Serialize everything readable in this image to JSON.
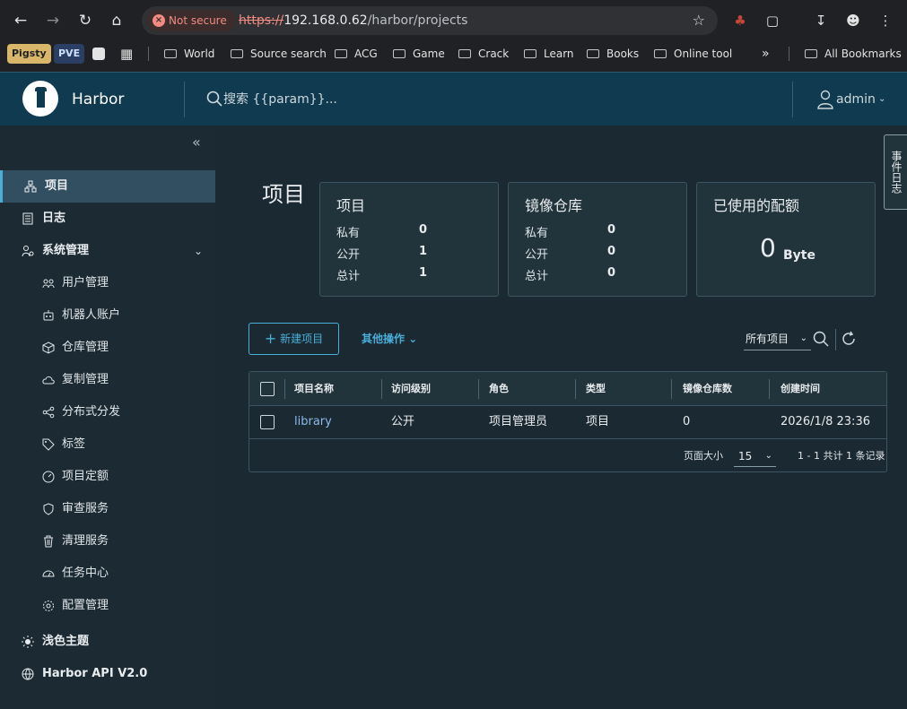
{
  "browser": {
    "security_label": "Not secure",
    "url_scheme": "https://",
    "url_host": "192.168.0.62",
    "url_path": "/harbor/projects",
    "bookmarks": {
      "pigsty": "Pigsty",
      "pve": "PVE",
      "world": "World",
      "source_search": "Source search",
      "acg": "ACG",
      "game": "Game",
      "crack": "Crack",
      "learn": "Learn",
      "books": "Books",
      "online_tool": "Online tool",
      "more": "»",
      "all_bookmarks": "All Bookmarks"
    }
  },
  "header": {
    "brand": "Harbor",
    "search_placeholder": "搜索 {{param}}...",
    "user": "admin"
  },
  "sidebar": {
    "projects": "项目",
    "logs": "日志",
    "admin": "系统管理",
    "sub": {
      "users": "用户管理",
      "robots": "机器人账户",
      "registries": "仓库管理",
      "replications": "复制管理",
      "distributions": "分布式分发",
      "labels": "标签",
      "quotas": "项目定额",
      "interrogation": "审查服务",
      "gc": "清理服务",
      "jobs": "任务中心",
      "config": "配置管理"
    },
    "theme": "浅色主题",
    "api": "Harbor API V2.0"
  },
  "main": {
    "title": "项目",
    "cards": {
      "projects": {
        "title": "项目",
        "private_label": "私有",
        "private_value": "0",
        "public_label": "公开",
        "public_value": "1",
        "total_label": "总计",
        "total_value": "1"
      },
      "repos": {
        "title": "镜像仓库",
        "private_label": "私有",
        "private_value": "0",
        "public_label": "公开",
        "public_value": "0",
        "total_label": "总计",
        "total_value": "0"
      },
      "quota": {
        "title": "已使用的配额",
        "value": "0",
        "unit": "Byte"
      }
    },
    "new_project": "新建项目",
    "more_actions": "其他操作",
    "filter_value": "所有项目",
    "table": {
      "headers": [
        "项目名称",
        "访问级别",
        "角色",
        "类型",
        "镜像仓库数",
        "创建时间"
      ],
      "rows": [
        {
          "name": "library",
          "access": "公开",
          "role": "项目管理员",
          "type": "项目",
          "repos": "0",
          "created": "2026/1/8 23:36"
        }
      ],
      "page_size_label": "页面大小",
      "page_size": "15",
      "summary": "1 - 1 共计 1 条记录"
    },
    "event_log": "事件日志"
  }
}
